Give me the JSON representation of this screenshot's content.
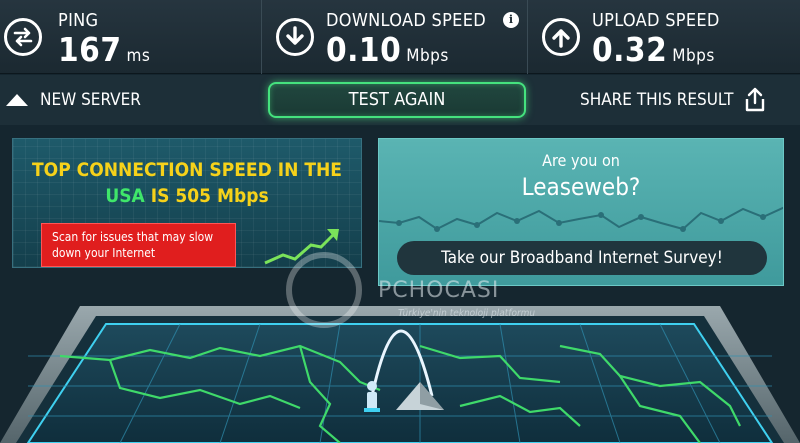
{
  "metrics": {
    "ping": {
      "label": "PING",
      "value": "167",
      "unit": "ms",
      "icon": "exchange-arrows-icon"
    },
    "download": {
      "label": "DOWNLOAD SPEED",
      "value": "0.10",
      "unit": "Mbps",
      "icon": "download-arrow-icon",
      "info_glyph": "i"
    },
    "upload": {
      "label": "UPLOAD SPEED",
      "value": "0.32",
      "unit": "Mbps",
      "icon": "upload-arrow-icon"
    }
  },
  "actions": {
    "new_server": "NEW SERVER",
    "test_again": "TEST AGAIN",
    "share": "SHARE THIS RESULT"
  },
  "promo": {
    "headline_line1": "TOP CONNECTION SPEED IN THE",
    "country": "USA",
    "headline_rest": "IS 505 Mbps",
    "scan_button": "Scan for issues that may slow down your Internet"
  },
  "survey": {
    "question": "Are you on",
    "isp": "Leaseweb?",
    "cta": "Take our Broadband Internet Survey!"
  },
  "watermark": {
    "name": "PCHOCASI",
    "tagline": "Türkiye'nin teknoloji platformu"
  },
  "colors": {
    "accent_green": "#45e27e",
    "headline_yellow": "#f6d21a",
    "usa_green": "#3fe66a",
    "scan_red": "#e01e1e",
    "survey_teal": "#5ab4b3",
    "map_glow": "#3fd0f0"
  }
}
